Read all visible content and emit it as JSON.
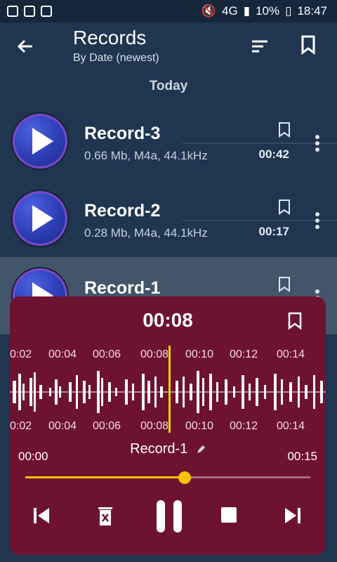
{
  "status": {
    "network": "4G",
    "battery": "10%",
    "time": "18:47"
  },
  "appbar": {
    "title": "Records",
    "subtitle": "By Date (newest)"
  },
  "section": "Today",
  "records": [
    {
      "name": "Record-3",
      "meta": "0.66 Mb, M4a, 44.1kHz",
      "duration": "00:42"
    },
    {
      "name": "Record-2",
      "meta": "0.28 Mb, M4a, 44.1kHz",
      "duration": "00:17"
    },
    {
      "name": "Record-1"
    }
  ],
  "player": {
    "current_time": "00:08",
    "file_name": "Record-1",
    "start": "00:00",
    "end": "00:15",
    "progress": 0.56,
    "scale_labels": [
      "0:02",
      "00:04",
      "00:06",
      "00:08",
      "00:10",
      "00:12",
      "00:14"
    ]
  },
  "colors": {
    "accent": "#f5c300",
    "player_bg": "#6e1231",
    "list_bg": "#1f3550"
  }
}
